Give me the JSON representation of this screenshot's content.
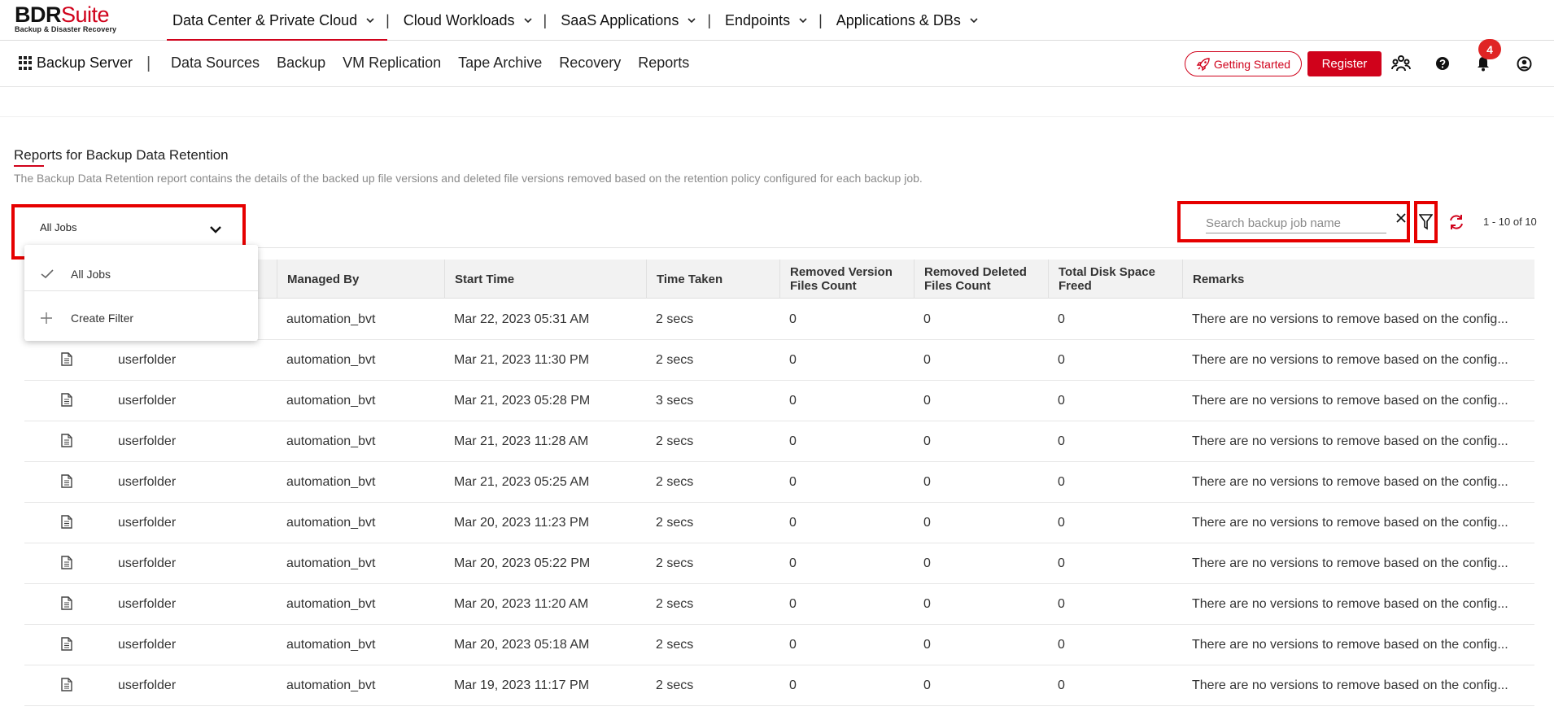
{
  "logo": {
    "brand_part1": "BDR",
    "brand_part2": "Suite",
    "tagline": "Backup & Disaster Recovery"
  },
  "product_nav": [
    {
      "label": "Data Center & Private Cloud",
      "active": true
    },
    {
      "label": "Cloud Workloads"
    },
    {
      "label": "SaaS Applications"
    },
    {
      "label": "Endpoints"
    },
    {
      "label": "Applications & DBs"
    }
  ],
  "separator": "|",
  "subnav": {
    "server_label": "Backup Server",
    "divider": "|",
    "items": [
      "Data Sources",
      "Backup",
      "VM Replication",
      "Tape Archive",
      "Recovery",
      "Reports"
    ]
  },
  "header_actions": {
    "getting_started": "Getting Started",
    "register": "Register",
    "notification_count": "4",
    "icons": [
      "users-icon",
      "help-icon",
      "bell-icon",
      "user-account-icon"
    ]
  },
  "page": {
    "title": "Reports for Backup Data Retention",
    "description": "The Backup Data Retention report contains the details of the backed up file versions and deleted file versions removed based on the retention policy configured for each backup job."
  },
  "filter": {
    "selected": "All Jobs",
    "options": [
      {
        "label": "All Jobs",
        "icon": "check-icon",
        "selected": true
      },
      {
        "label": "Create Filter",
        "icon": "plus-icon"
      }
    ]
  },
  "search": {
    "placeholder": "Search backup job name",
    "value": ""
  },
  "pager": "1 - 10 of 10",
  "table": {
    "columns": [
      "Managed By",
      "Start Time",
      "Time Taken",
      "Removed Version Files Count",
      "Removed Deleted Files Count",
      "Total Disk Space Freed",
      "Remarks"
    ],
    "rows": [
      {
        "name": "",
        "managed_by": "automation_bvt",
        "start": "Mar 22, 2023 05:31 AM",
        "taken": "2 secs",
        "rv": "0",
        "rd": "0",
        "freed": "0",
        "remarks": "There are no versions to remove based on the config..."
      },
      {
        "name": "userfolder",
        "managed_by": "automation_bvt",
        "start": "Mar 21, 2023 11:30 PM",
        "taken": "2 secs",
        "rv": "0",
        "rd": "0",
        "freed": "0",
        "remarks": "There are no versions to remove based on the config..."
      },
      {
        "name": "userfolder",
        "managed_by": "automation_bvt",
        "start": "Mar 21, 2023 05:28 PM",
        "taken": "3 secs",
        "rv": "0",
        "rd": "0",
        "freed": "0",
        "remarks": "There are no versions to remove based on the config..."
      },
      {
        "name": "userfolder",
        "managed_by": "automation_bvt",
        "start": "Mar 21, 2023 11:28 AM",
        "taken": "2 secs",
        "rv": "0",
        "rd": "0",
        "freed": "0",
        "remarks": "There are no versions to remove based on the config..."
      },
      {
        "name": "userfolder",
        "managed_by": "automation_bvt",
        "start": "Mar 21, 2023 05:25 AM",
        "taken": "2 secs",
        "rv": "0",
        "rd": "0",
        "freed": "0",
        "remarks": "There are no versions to remove based on the config..."
      },
      {
        "name": "userfolder",
        "managed_by": "automation_bvt",
        "start": "Mar 20, 2023 11:23 PM",
        "taken": "2 secs",
        "rv": "0",
        "rd": "0",
        "freed": "0",
        "remarks": "There are no versions to remove based on the config..."
      },
      {
        "name": "userfolder",
        "managed_by": "automation_bvt",
        "start": "Mar 20, 2023 05:22 PM",
        "taken": "2 secs",
        "rv": "0",
        "rd": "0",
        "freed": "0",
        "remarks": "There are no versions to remove based on the config..."
      },
      {
        "name": "userfolder",
        "managed_by": "automation_bvt",
        "start": "Mar 20, 2023 11:20 AM",
        "taken": "2 secs",
        "rv": "0",
        "rd": "0",
        "freed": "0",
        "remarks": "There are no versions to remove based on the config..."
      },
      {
        "name": "userfolder",
        "managed_by": "automation_bvt",
        "start": "Mar 20, 2023 05:18 AM",
        "taken": "2 secs",
        "rv": "0",
        "rd": "0",
        "freed": "0",
        "remarks": "There are no versions to remove based on the config..."
      },
      {
        "name": "userfolder",
        "managed_by": "automation_bvt",
        "start": "Mar 19, 2023 11:17 PM",
        "taken": "2 secs",
        "rv": "0",
        "rd": "0",
        "freed": "0",
        "remarks": "There are no versions to remove based on the config..."
      }
    ]
  },
  "colors": {
    "accent": "#d0021b",
    "highlight": "#e60000",
    "badge": "#e02424"
  }
}
